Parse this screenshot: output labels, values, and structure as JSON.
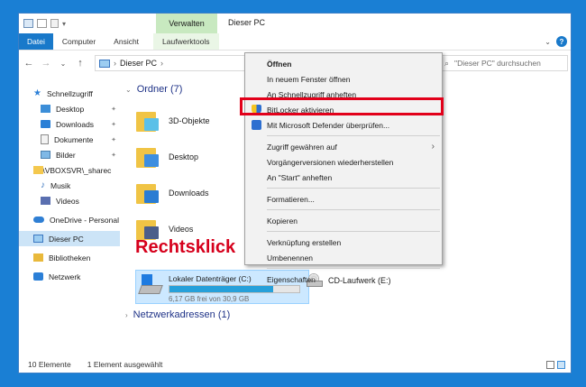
{
  "window": {
    "title": "Dieser PC",
    "context_tab_group": "Verwalten"
  },
  "ribbon": {
    "tabs": [
      "Datei",
      "Computer",
      "Ansicht",
      "Laufwerktools"
    ],
    "help": "?"
  },
  "address": {
    "back": "←",
    "forward": "→",
    "recent": "⌄",
    "up": "↑",
    "location": "Dieser PC",
    "separator": "›",
    "search_placeholder": "\"Dieser PC\" durchsuchen"
  },
  "navpane": {
    "quick_access": "Schnellzugriff",
    "quick_items": [
      {
        "label": "Desktop",
        "icon": "desktop-icon",
        "pinned": true
      },
      {
        "label": "Downloads",
        "icon": "downloads-icon",
        "pinned": true
      },
      {
        "label": "Dokumente",
        "icon": "documents-icon",
        "pinned": true
      },
      {
        "label": "Bilder",
        "icon": "pictures-icon",
        "pinned": true
      },
      {
        "label": "\\\\VBOXSVR\\_sharec",
        "icon": "network-share-icon",
        "pinned": false
      },
      {
        "label": "Musik",
        "icon": "music-icon",
        "pinned": false
      },
      {
        "label": "Videos",
        "icon": "videos-icon",
        "pinned": false
      }
    ],
    "onedrive": "OneDrive - Personal",
    "this_pc": "Dieser PC",
    "libraries": "Bibliotheken",
    "network": "Netzwerk"
  },
  "content": {
    "folders_header": "Ordner (7)",
    "folders": [
      "3D-Objekte",
      "Desktop",
      "Downloads",
      "Videos"
    ],
    "drive": {
      "name": "Lokaler Datenträger (C:)",
      "free": "6,17 GB frei von 30,9 GB",
      "used_fraction": 0.8
    },
    "cd_drive": "CD-Laufwerk (E:)",
    "network_header": "Netzwerkadressen (1)",
    "annotation": "Rechtsklick"
  },
  "context_menu": {
    "items": [
      {
        "label": "Öffnen",
        "bold": true
      },
      {
        "label": "In neuem Fenster öffnen"
      },
      {
        "label": "An Schnellzugriff anheften"
      },
      {
        "label": "BitLocker aktivieren",
        "icon": "bitlocker-shield-icon",
        "highlighted": true
      },
      {
        "label": "Mit Microsoft Defender überprüfen...",
        "icon": "defender-icon"
      },
      {
        "label": "Zugriff gewähren auf",
        "submenu": true
      },
      {
        "label": "Vorgängerversionen wiederherstellen"
      },
      {
        "label": "An \"Start\" anheften"
      },
      {
        "label": "Formatieren..."
      },
      {
        "label": "Kopieren"
      },
      {
        "label": "Verknüpfung erstellen"
      },
      {
        "label": "Umbenennen"
      },
      {
        "label": "Eigenschaften"
      }
    ],
    "submenu_arrow": "›",
    "highlight_color": "#e2001a"
  },
  "statusbar": {
    "count": "10 Elemente",
    "selected": "1 Element ausgewählt"
  },
  "colors": {
    "accent": "#1979ca",
    "selection": "#cce8ff",
    "annotation": "#d6001c"
  }
}
